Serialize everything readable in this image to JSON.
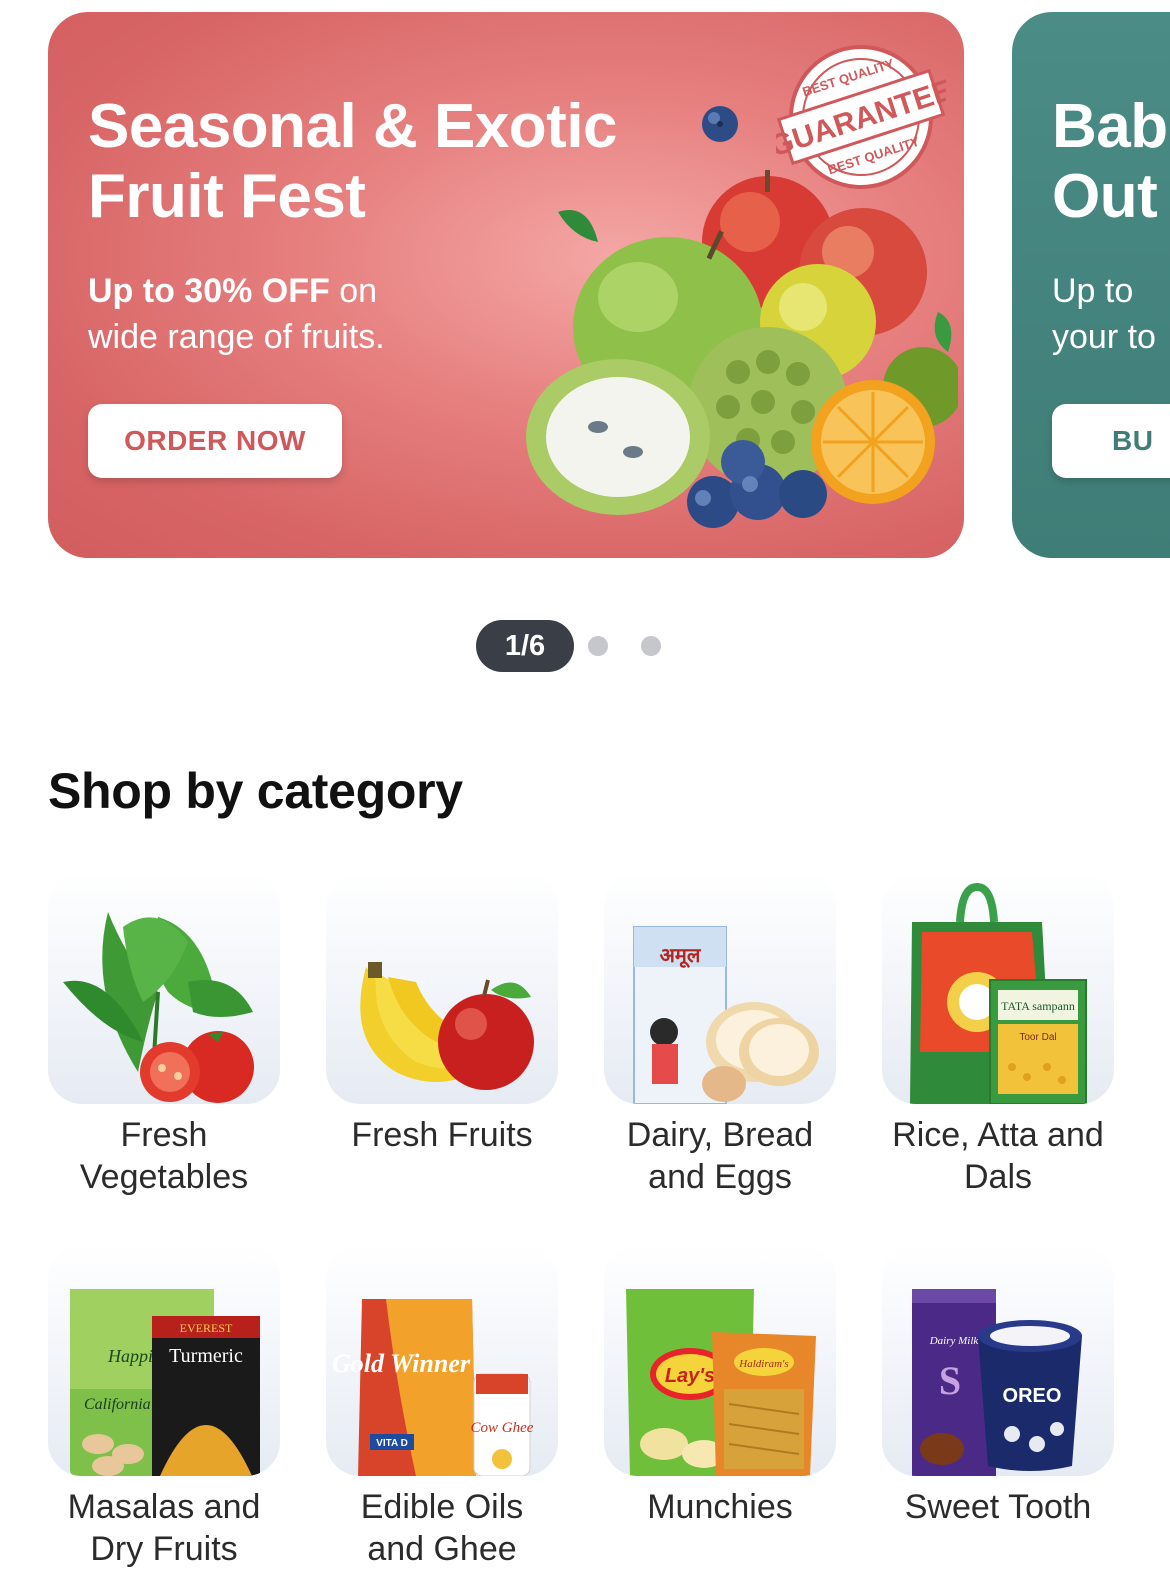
{
  "carousel": {
    "banners": [
      {
        "title_line1": "Seasonal & Exotic",
        "title_line2": "Fruit Fest",
        "subtitle_bold": "Up to 30% OFF",
        "subtitle_rest_1": " on",
        "subtitle_line2": "wide range of fruits.",
        "cta": "ORDER NOW",
        "badge_top": "BEST QUALITY",
        "badge_main": "GUARANTEE",
        "badge_bottom": "BEST QUALITY",
        "colors": {
          "bg": "#d86566",
          "cta_text": "#d0585a"
        }
      },
      {
        "title_line1": "Bab",
        "title_line2": "Out",
        "subtitle_line1": "Up to",
        "subtitle_line2": "your to",
        "cta": "BU",
        "colors": {
          "bg": "#3f7d77"
        }
      }
    ],
    "pager": {
      "label": "1/6"
    }
  },
  "section": {
    "title": "Shop by category"
  },
  "categories": [
    {
      "line1": "Fresh",
      "line2": "Vegetables",
      "icon": "vegetables-icon"
    },
    {
      "line1": "Fresh Fruits",
      "line2": "",
      "icon": "fruits-icon"
    },
    {
      "line1": "Dairy, Bread",
      "line2": "and Eggs",
      "icon": "dairy-icon",
      "pack_text": "अमूल"
    },
    {
      "line1": "Rice, Atta and",
      "line2": "Dals",
      "icon": "rice-atta-icon",
      "pack_text": "TATA sampann",
      "pack_sub": "Toor Dal"
    },
    {
      "line1": "Masalas and",
      "line2": "Dry Fruits",
      "icon": "masala-icon",
      "pack_text": "EVEREST",
      "pack_sub": "Turmeric",
      "pack2_text": "Happi",
      "pack2_sub": "California A"
    },
    {
      "line1": "Edible Oils",
      "line2": "and Ghee",
      "icon": "oil-ghee-icon",
      "pack_text": "Gold Winner",
      "pack_sub": "VITA D",
      "pack2_text": "Cow Ghee"
    },
    {
      "line1": "Munchies",
      "line2": "",
      "icon": "munchies-icon",
      "pack_text": "Lay's",
      "pack2_text": "Haldiram's"
    },
    {
      "line1": "Sweet Tooth",
      "line2": "",
      "icon": "sweets-icon",
      "pack_text": "Dairy Milk",
      "pack2_text": "OREO"
    }
  ]
}
